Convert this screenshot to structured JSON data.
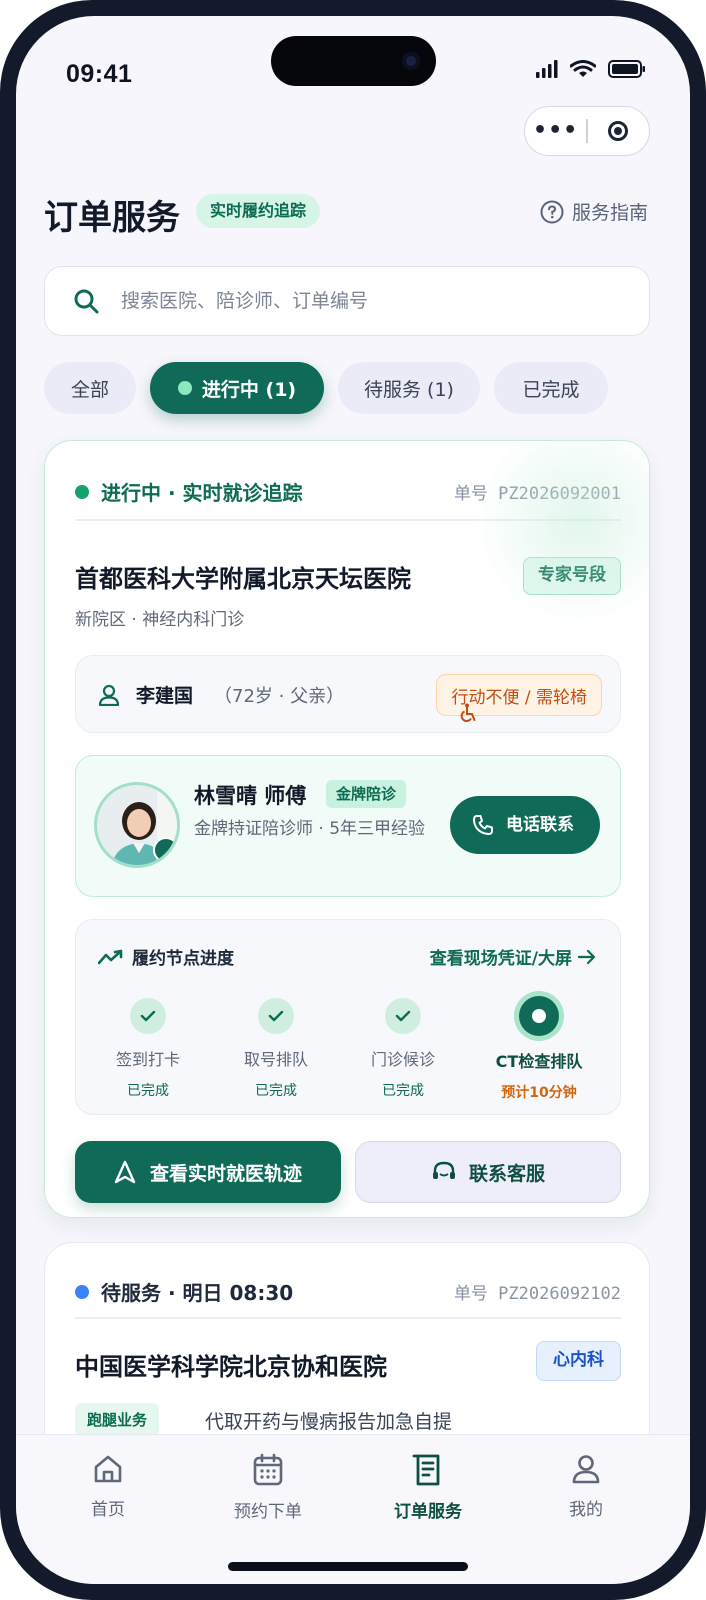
{
  "status_bar": {
    "time": "09:41"
  },
  "capsule": {
    "more": "•••"
  },
  "header": {
    "title": "订单服务",
    "badge": "实时履约追踪",
    "guide": "服务指南"
  },
  "search": {
    "placeholder": "搜索医院、陪诊师、订单编号"
  },
  "tabs": [
    {
      "label": "全部"
    },
    {
      "label": "进行中 (1)"
    },
    {
      "label": "待服务 (1)"
    },
    {
      "label": "已完成"
    }
  ],
  "order1": {
    "status": "进行中 · 实时就诊追踪",
    "order_no": "单号 PZ2026092001",
    "hospital": "首都医科大学附属北京天坛医院",
    "tag": "专家号段",
    "dept": "新院区 · 神经内科门诊",
    "patient": {
      "name": "李建国",
      "info": "（72岁 · 父亲）",
      "warning": "行动不便 / 需轮椅"
    },
    "escort": {
      "name": "林雪晴 师傅",
      "badge": "金牌陪诊",
      "desc": "金牌持证陪诊师 · 5年三甲经验",
      "call": "电话联系"
    },
    "progress": {
      "title": "履约节点进度",
      "link": "查看现场凭证/大屏",
      "steps": [
        {
          "label": "签到打卡",
          "status": "已完成"
        },
        {
          "label": "取号排队",
          "status": "已完成"
        },
        {
          "label": "门诊候诊",
          "status": "已完成"
        },
        {
          "label": "CT检查排队",
          "status": "预计10分钟"
        }
      ]
    },
    "buttons": {
      "track": "查看实时就医轨迹",
      "service": "联系客服"
    }
  },
  "order2": {
    "status": "待服务 · 明日 08:30",
    "order_no": "单号 PZ2026092102",
    "hospital": "中国医学科学院北京协和医院",
    "tag": "心内科",
    "run_tag": "跑腿业务",
    "desc": "代取开药与慢病报告加急自提"
  },
  "bottom_nav": [
    {
      "label": "首页",
      "icon": "home-icon"
    },
    {
      "label": "预约下单",
      "icon": "calendar-icon"
    },
    {
      "label": "订单服务",
      "icon": "receipt-icon"
    },
    {
      "label": "我的",
      "icon": "user-icon"
    }
  ],
  "colors": {
    "primary": "#0f6b58",
    "accent_light": "#d7f5e6",
    "warning": "#c14e12",
    "info": "#1d52c9",
    "pending_dot": "#3b82f6",
    "active_dot": "#16a36b"
  }
}
